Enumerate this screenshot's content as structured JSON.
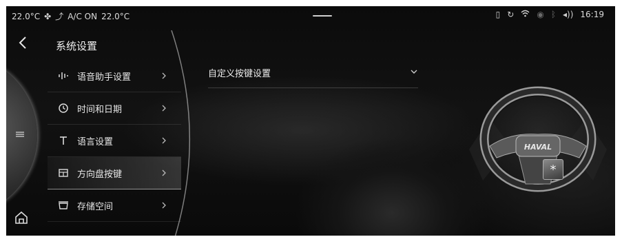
{
  "status_bar": {
    "outside_temp": "22.0°C",
    "ac_status": "A/C ON",
    "inside_temp": "22.0°C",
    "time": "16:19"
  },
  "header": {
    "title": "系统设置"
  },
  "menu": {
    "items": [
      {
        "label": "语音助手设置",
        "icon": "voice-icon"
      },
      {
        "label": "时间和日期",
        "icon": "clock-icon"
      },
      {
        "label": "语言设置",
        "icon": "text-icon"
      },
      {
        "label": "方向盘按键",
        "icon": "steering-key-icon",
        "active": true
      },
      {
        "label": "存储空间",
        "icon": "storage-icon"
      }
    ]
  },
  "content": {
    "dropdown_label": "自定义按键设置",
    "wheel_logo": "HAVAL",
    "custom_key_symbol": "*"
  }
}
